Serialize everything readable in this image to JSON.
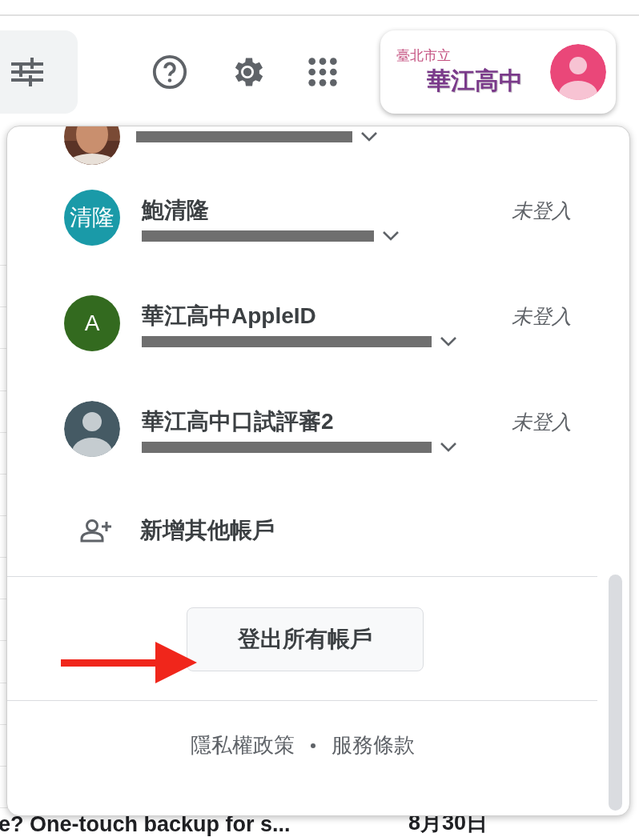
{
  "account_chip": {
    "subtitle": "臺北市立",
    "title": "華江高中"
  },
  "clipped_account": {
    "avatar": {
      "kind": "picture"
    }
  },
  "accounts": [
    {
      "name": "鮑清隆",
      "status": "未登入",
      "kind": "initials",
      "avatar_text": "清隆",
      "color": "#1a9aa8"
    },
    {
      "name": "華江高中AppleID",
      "status": "未登入",
      "kind": "initials",
      "avatar_text": "A",
      "color": "#336a1f"
    },
    {
      "name": "華江高中口試評審2",
      "status": "未登入",
      "kind": "silhouette",
      "color": "#455a64"
    }
  ],
  "add_account": "新增其他帳戶",
  "sign_out_all": "登出所有帳戶",
  "footer_links": [
    "隱私權政策",
    "服務條款"
  ],
  "background_row": {
    "subject": "e? One-touch backup for s...",
    "date": "8月30日"
  }
}
